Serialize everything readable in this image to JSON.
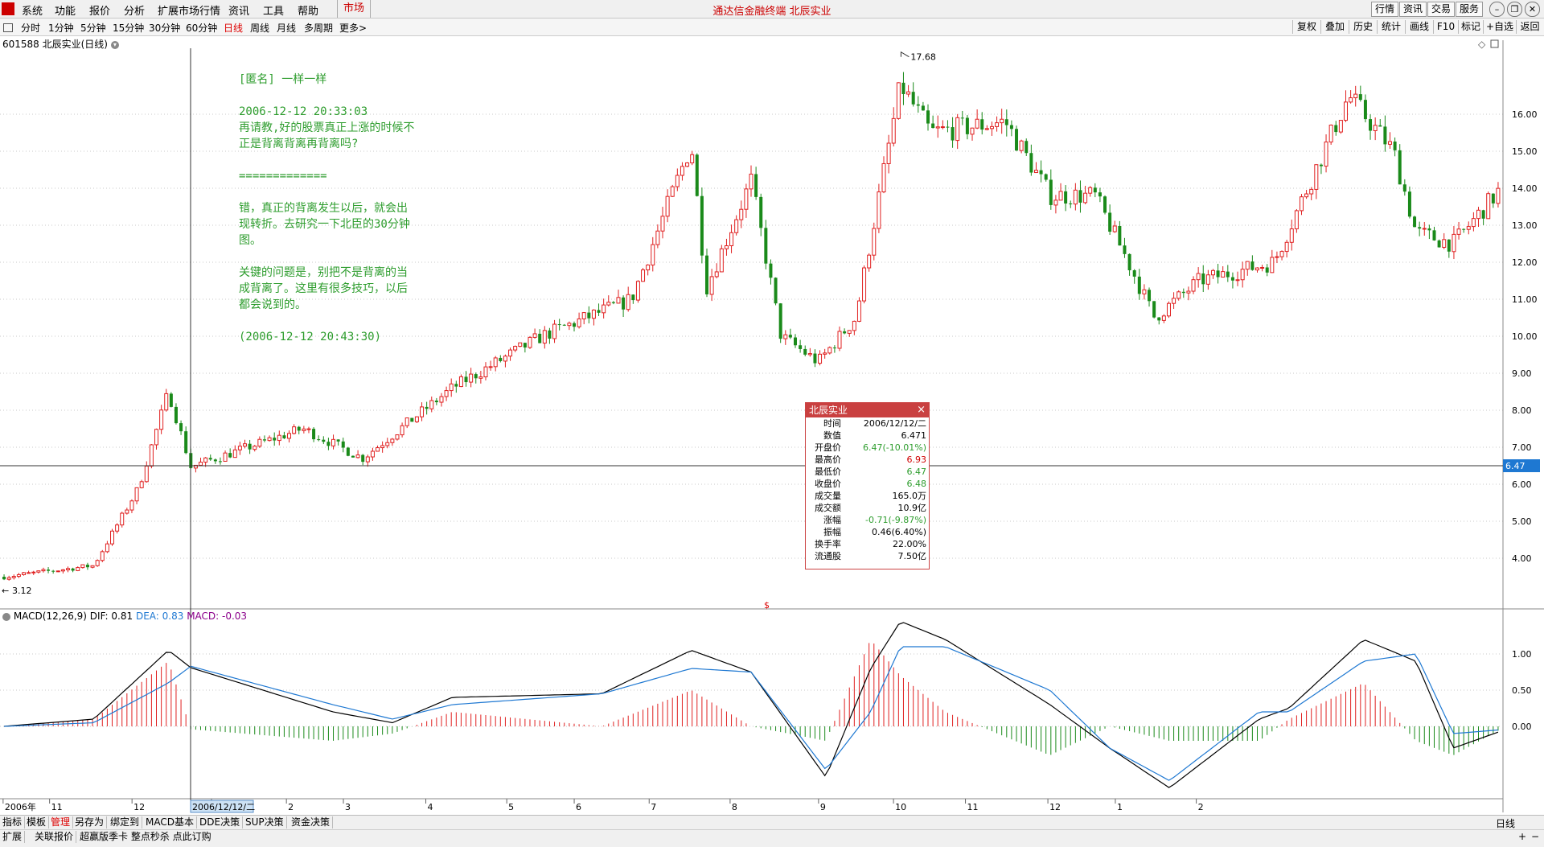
{
  "menubar": {
    "items": [
      "系统",
      "功能",
      "报价",
      "分析",
      "扩展市场行情",
      "资讯",
      "工具",
      "帮助"
    ],
    "market_tab": "市场",
    "app_title": "通达信金融终端 北辰实业",
    "right_buttons": [
      "行情",
      "资讯",
      "交易",
      "服务"
    ]
  },
  "periods": {
    "items": [
      "分时",
      "1分钟",
      "5分钟",
      "15分钟",
      "30分钟",
      "60分钟",
      "日线",
      "周线",
      "月线",
      "多周期",
      "更多"
    ],
    "active": "日线",
    "more_arrow": ">",
    "right_tools": [
      "复权",
      "叠加",
      "历史",
      "统计",
      "画线",
      "F10",
      "标记",
      "+自选",
      "返回"
    ]
  },
  "stock": {
    "label": "601588 北辰实业(日线)"
  },
  "note": {
    "lines": [
      "[匿名] 一样一样",
      "",
      "2006-12-12 20:33:03",
      "再请教,好的股票真正上涨的时候不正是背离背离再背离吗?",
      "",
      "=============",
      "",
      "错，真正的背离发生以后，就会出现转折。去研究一下北臣的30分钟图。",
      "",
      "关键的问题是，别把不是背离的当成背离了。这里有很多技巧，以后都会说到的。",
      "",
      "(2006-12-12 20:43:30)"
    ]
  },
  "popup": {
    "title": "北辰实业",
    "close": "×",
    "rows": [
      {
        "label": "时间",
        "value": "2006/12/12/二",
        "color": "#000000"
      },
      {
        "label": "数值",
        "value": "6.471",
        "color": "#000000"
      },
      {
        "label": "开盘价",
        "value": "6.47(-10.01%)",
        "color": "#2e9d2e"
      },
      {
        "label": "最高价",
        "value": "6.93",
        "color": "#d00000"
      },
      {
        "label": "最低价",
        "value": "6.47",
        "color": "#2e9d2e"
      },
      {
        "label": "收盘价",
        "value": "6.48",
        "color": "#2e9d2e"
      },
      {
        "label": "成交量",
        "value": "165.0万",
        "color": "#000000"
      },
      {
        "label": "成交额",
        "value": "10.9亿",
        "color": "#000000"
      },
      {
        "label": "涨幅",
        "value": "-0.71(-9.87%)",
        "color": "#2e9d2e"
      },
      {
        "label": "振幅",
        "value": "0.46(6.40%)",
        "color": "#000000"
      },
      {
        "label": "换手率",
        "value": "22.00%",
        "color": "#000000"
      },
      {
        "label": "流通股",
        "value": "7.50亿",
        "color": "#000000"
      }
    ]
  },
  "price_axis": {
    "ticks": [
      "16.00",
      "15.00",
      "14.00",
      "13.00",
      "12.00",
      "11.00",
      "10.00",
      "9.00",
      "8.00",
      "7.00",
      "6.00",
      "5.00",
      "4.00"
    ],
    "crosshair_value": "6.47",
    "high_label": "17.68",
    "low_label": "3.12"
  },
  "macd": {
    "label": "MACD(12,26,9)",
    "dif": "DIF: 0.81",
    "dea": "DEA: 0.83",
    "macd": "MACD: -0.03",
    "ticks": [
      "1.00",
      "0.50",
      "0.00"
    ]
  },
  "time_axis": {
    "labels": [
      "2006年",
      "11",
      "12",
      "1",
      "2",
      "3",
      "4",
      "5",
      "6",
      "7",
      "8",
      "9",
      "10",
      "11",
      "12",
      "1",
      "2"
    ],
    "crosshair_date": "2006/12/12/二"
  },
  "colors": {
    "up": "#e02020",
    "down": "#1a8a1a",
    "dif": "#000000",
    "dea": "#1e78d2",
    "macd_label": "#8b008b",
    "grid": "#c8c8c8"
  },
  "bottom": {
    "tabs": [
      "指标",
      "模板",
      "管理",
      "另存为",
      "绑定到",
      "MACD基本",
      "DDE决策",
      "SUP决策",
      "资金决策"
    ],
    "active_tab": "管理",
    "period": "日线",
    "plus": "+",
    "minus": "−",
    "row2": [
      "扩展",
      "关联报价",
      "超赢版季卡 整点秒杀 点此订购"
    ]
  },
  "chart_data": {
    "type": "candlestick",
    "ylim": [
      3.12,
      17.68
    ],
    "waypoints": [
      {
        "x": 0,
        "y": 3.5
      },
      {
        "x": 0.06,
        "y": 3.8
      },
      {
        "x": 0.09,
        "y": 5.9
      },
      {
        "x": 0.11,
        "y": 8.5
      },
      {
        "x": 0.125,
        "y": 6.47
      },
      {
        "x": 0.2,
        "y": 7.5
      },
      {
        "x": 0.24,
        "y": 6.7
      },
      {
        "x": 0.3,
        "y": 8.6
      },
      {
        "x": 0.36,
        "y": 10.0
      },
      {
        "x": 0.42,
        "y": 11.0
      },
      {
        "x": 0.46,
        "y": 15.2
      },
      {
        "x": 0.47,
        "y": 11.3
      },
      {
        "x": 0.5,
        "y": 14.2
      },
      {
        "x": 0.52,
        "y": 10.0
      },
      {
        "x": 0.545,
        "y": 9.3
      },
      {
        "x": 0.57,
        "y": 10.5
      },
      {
        "x": 0.6,
        "y": 16.8
      },
      {
        "x": 0.62,
        "y": 15.5
      },
      {
        "x": 0.67,
        "y": 15.8
      },
      {
        "x": 0.7,
        "y": 13.8
      },
      {
        "x": 0.73,
        "y": 13.8
      },
      {
        "x": 0.75,
        "y": 12.2
      },
      {
        "x": 0.77,
        "y": 10.5
      },
      {
        "x": 0.8,
        "y": 11.5
      },
      {
        "x": 0.85,
        "y": 12.0
      },
      {
        "x": 0.9,
        "y": 16.5
      },
      {
        "x": 0.93,
        "y": 15.0
      },
      {
        "x": 0.945,
        "y": 12.8
      },
      {
        "x": 0.97,
        "y": 12.5
      },
      {
        "x": 1.0,
        "y": 13.9
      }
    ],
    "macd_waypoints": [
      {
        "x": 0,
        "dif": 0,
        "dea": 0
      },
      {
        "x": 0.06,
        "dif": 0.1,
        "dea": 0.05
      },
      {
        "x": 0.11,
        "dif": 1.05,
        "dea": 0.6
      },
      {
        "x": 0.125,
        "dif": 0.81,
        "dea": 0.83
      },
      {
        "x": 0.22,
        "dif": 0.2,
        "dea": 0.3
      },
      {
        "x": 0.26,
        "dif": 0.05,
        "dea": 0.1
      },
      {
        "x": 0.3,
        "dif": 0.4,
        "dea": 0.3
      },
      {
        "x": 0.4,
        "dif": 0.45,
        "dea": 0.45
      },
      {
        "x": 0.46,
        "dif": 1.05,
        "dea": 0.8
      },
      {
        "x": 0.5,
        "dif": 0.75,
        "dea": 0.75
      },
      {
        "x": 0.55,
        "dif": -0.7,
        "dea": -0.6
      },
      {
        "x": 0.58,
        "dif": 0.8,
        "dea": 0.2
      },
      {
        "x": 0.6,
        "dif": 1.45,
        "dea": 1.1
      },
      {
        "x": 0.63,
        "dif": 1.2,
        "dea": 1.1
      },
      {
        "x": 0.7,
        "dif": 0.3,
        "dea": 0.5
      },
      {
        "x": 0.74,
        "dif": -0.3,
        "dea": -0.3
      },
      {
        "x": 0.78,
        "dif": -0.85,
        "dea": -0.75
      },
      {
        "x": 0.84,
        "dif": 0.1,
        "dea": 0.2
      },
      {
        "x": 0.86,
        "dif": 0.25,
        "dea": 0.2
      },
      {
        "x": 0.91,
        "dif": 1.2,
        "dea": 0.9
      },
      {
        "x": 0.945,
        "dif": 0.9,
        "dea": 1.0
      },
      {
        "x": 0.97,
        "dif": -0.3,
        "dea": -0.1
      },
      {
        "x": 1.0,
        "dif": -0.08,
        "dea": -0.05
      }
    ]
  }
}
